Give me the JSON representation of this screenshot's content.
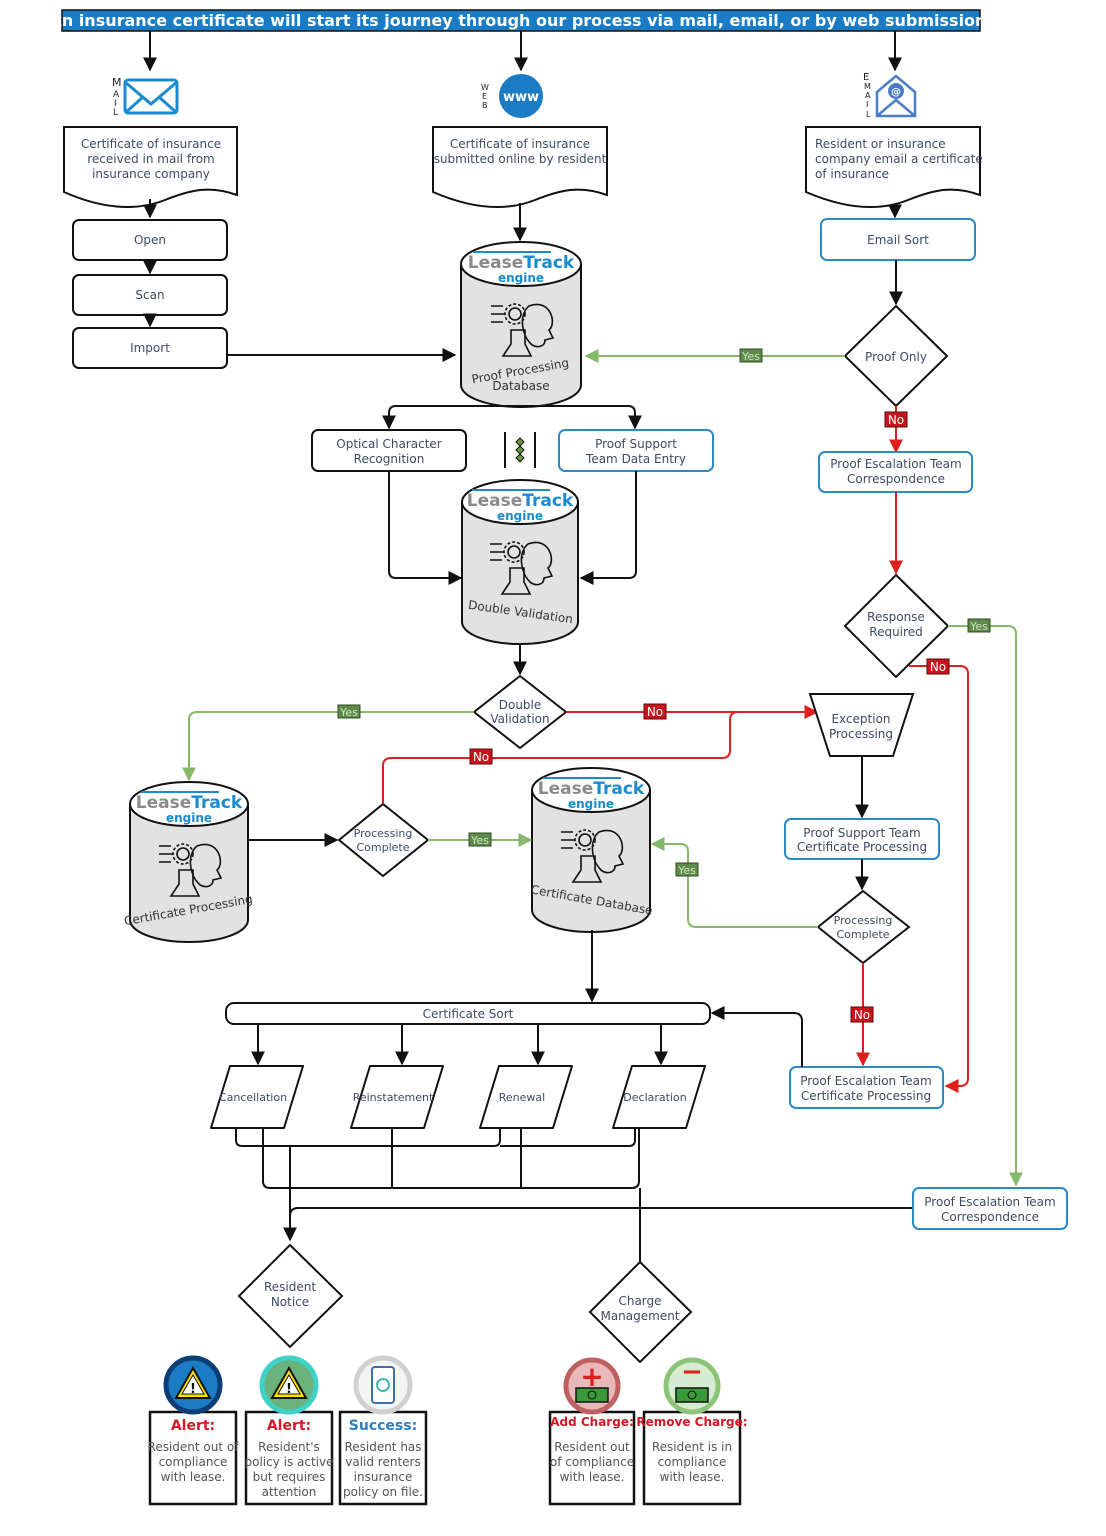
{
  "header": {
    "title": "An insurance certificate will start its journey through our process via mail, email, or by web submission."
  },
  "channels": {
    "mail": {
      "label": "MAIL",
      "icon": "envelope-icon",
      "document": [
        "Certificate of insurance",
        "received in mail from",
        "insurance company"
      ]
    },
    "web": {
      "label": "WEB",
      "icon": "www-globe-icon",
      "icon_text": "www",
      "document": [
        "Certificate of insurance",
        "submitted online by resident"
      ]
    },
    "email": {
      "label": "EMAIL",
      "icon": "email-envelope-at-icon",
      "document": [
        "Resident or insurance",
        "company email a certificate",
        "of insurance"
      ]
    }
  },
  "mail_steps": [
    "Open",
    "Scan",
    "Import"
  ],
  "email_sort": "Email Sort",
  "engine": {
    "brand_gray": "Lease",
    "brand_blue": "Track",
    "sub": "engine"
  },
  "databases": {
    "proof_processing": [
      "Proof Processing",
      "Database"
    ],
    "double_validation": "Double Validation",
    "certificate_processing": "Certificate Processing",
    "certificate_database": "Certificate Database"
  },
  "process": {
    "ocr": [
      "Optical Character",
      "Recognition"
    ],
    "proof_support_data_entry": [
      "Proof Support",
      "Team Data Entry"
    ],
    "proof_escalation_correspondence": [
      "Proof Escalation Team",
      "Correspondence"
    ],
    "exception_processing": [
      "Exception",
      "Processing"
    ],
    "proof_support_cert_processing": [
      "Proof Support Team",
      "Certificate Processing"
    ],
    "proof_escalation_cert_processing": [
      "Proof Escalation Team",
      "Certificate Processing"
    ],
    "proof_escalation_correspondence_2": [
      "Proof Escalation Team",
      "Correspondence"
    ],
    "certificate_sort": "Certificate Sort"
  },
  "decisions": {
    "proof_only": [
      "Proof Only"
    ],
    "response_required": [
      "Response",
      "Required"
    ],
    "double_validation": [
      "Double",
      "Validation"
    ],
    "processing_complete_1": [
      "Processing",
      "Complete"
    ],
    "processing_complete_2": [
      "Processing",
      "Complete"
    ],
    "resident_notice": [
      "Resident",
      "Notice"
    ],
    "charge_management": [
      "Charge",
      "Management"
    ]
  },
  "sort_types": [
    "Cancellation",
    "Reinstatement",
    "Renewal",
    "Declaration"
  ],
  "tags": {
    "yes": "Yes",
    "no": "No"
  },
  "notices": [
    {
      "title": "Alert:",
      "color": "#d31a24",
      "icon": "warning-triangle-icon",
      "ring": "#0d3d75",
      "fill": "#1a7cc4",
      "body": [
        "Resident out of",
        "compliance",
        "with lease."
      ]
    },
    {
      "title": "Alert:",
      "color": "#d31a24",
      "icon": "warning-triangle-icon",
      "ring": "#3fd1c8",
      "fill": "#6bb37c",
      "body": [
        "Resident's",
        "policy is active",
        "but requires",
        "attention"
      ]
    },
    {
      "title": "Success:",
      "color": "#2a7fc0",
      "icon": "phone-certificate-icon",
      "ring": "#d0d0d0",
      "fill": "#f4f4f4",
      "body": [
        "Resident has",
        "valid renters",
        "insurance",
        "policy on file."
      ]
    }
  ],
  "charges": [
    {
      "title": "Add Charge:",
      "icon": "add-charge-money-icon",
      "sign": "+",
      "ring": "#c06060",
      "fill": "#e9b8b8",
      "body": [
        "Resident out",
        "of compliance",
        "with lease."
      ]
    },
    {
      "title": "Remove Charge:",
      "icon": "remove-charge-money-icon",
      "sign": "-",
      "ring": "#8cc47a",
      "fill": "#d6ecd0",
      "body": [
        "Resident is in",
        "compliance",
        "with lease."
      ]
    }
  ]
}
